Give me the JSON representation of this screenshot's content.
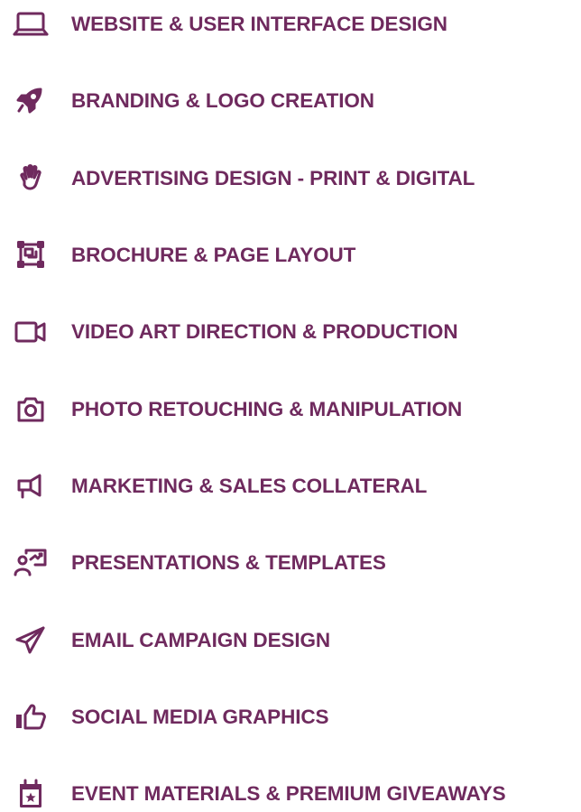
{
  "colors": {
    "accent": "#6f2a5e"
  },
  "services": [
    {
      "label": "WEBSITE & USER INTERFACE DESIGN",
      "icon": "laptop-icon"
    },
    {
      "label": "BRANDING & LOGO CREATION",
      "icon": "rocket-icon"
    },
    {
      "label": "ADVERTISING DESIGN - PRINT & DIGITAL",
      "icon": "hand-icon"
    },
    {
      "label": "BROCHURE & PAGE LAYOUT",
      "icon": "layout-icon"
    },
    {
      "label": "VIDEO ART DIRECTION & PRODUCTION",
      "icon": "video-camera-icon"
    },
    {
      "label": "PHOTO RETOUCHING & MANIPULATION",
      "icon": "camera-icon"
    },
    {
      "label": "MARKETING & SALES COLLATERAL",
      "icon": "megaphone-icon"
    },
    {
      "label": "PRESENTATIONS & TEMPLATES",
      "icon": "presentation-icon"
    },
    {
      "label": "EMAIL CAMPAIGN DESIGN",
      "icon": "paper-plane-icon"
    },
    {
      "label": "SOCIAL MEDIA GRAPHICS",
      "icon": "thumbs-up-icon"
    },
    {
      "label": "EVENT MATERIALS & PREMIUM GIVEAWAYS",
      "icon": "calendar-star-icon"
    }
  ]
}
